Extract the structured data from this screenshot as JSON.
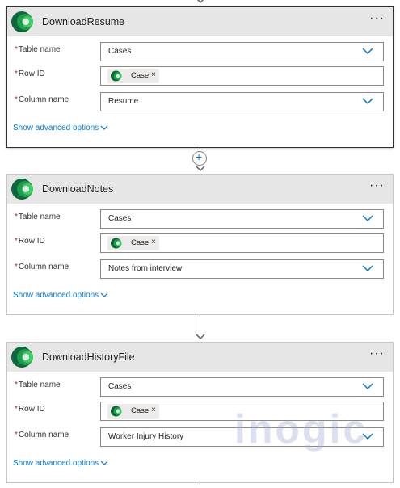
{
  "cards": [
    {
      "title": "DownloadResume",
      "fields": [
        {
          "label": "Table name",
          "value": "Cases"
        },
        {
          "label": "Row ID",
          "token": "Case",
          "token_remove": "×"
        },
        {
          "label": "Column name",
          "value": "Resume"
        }
      ],
      "advanced": "Show advanced options",
      "menu": "···"
    },
    {
      "title": "DownloadNotes",
      "fields": [
        {
          "label": "Table name",
          "value": "Cases"
        },
        {
          "label": "Row ID",
          "token": "Case",
          "token_remove": "×"
        },
        {
          "label": "Column name",
          "value": "Notes from interview"
        }
      ],
      "advanced": "Show advanced options",
      "menu": "···"
    },
    {
      "title": "DownloadHistoryFile",
      "fields": [
        {
          "label": "Table name",
          "value": "Cases"
        },
        {
          "label": "Row ID",
          "token": "Case",
          "token_remove": "×"
        },
        {
          "label": "Column name",
          "value": "Worker Injury History"
        }
      ],
      "advanced": "Show advanced options",
      "menu": "···"
    }
  ],
  "required_mark": "*",
  "insert_step": "+",
  "watermark": "inogic",
  "colors": {
    "header_bg": "#e6e6e6",
    "link": "#0078d4",
    "required": "#a4262c",
    "logo_dark": "#0b6a3b",
    "logo_light": "#3ccf63"
  }
}
